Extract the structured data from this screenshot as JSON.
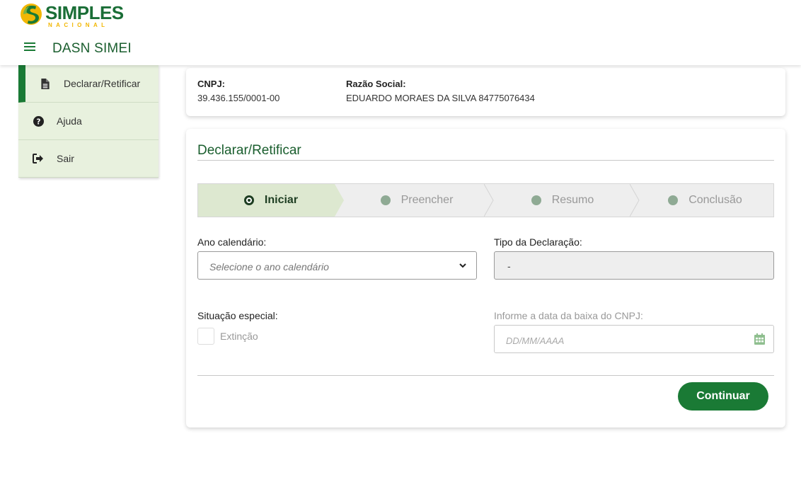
{
  "header": {
    "logo": {
      "main": "SIMPLES",
      "sub": "NACIONAL"
    },
    "app_title": "DASN SIMEI",
    "menu_icon": "hamburger-icon"
  },
  "sidebar": {
    "items": [
      {
        "label": "Declarar/Retificar",
        "icon": "file-icon",
        "active": true
      },
      {
        "label": "Ajuda",
        "icon": "question-circle-icon",
        "active": false
      },
      {
        "label": "Sair",
        "icon": "sign-out-icon",
        "active": false
      }
    ]
  },
  "info": {
    "cnpj_label": "CNPJ:",
    "cnpj_value": "39.436.155/0001-00",
    "razao_label": "Razão Social:",
    "razao_value": "EDUARDO MORAES DA SILVA 84775076434"
  },
  "main": {
    "title": "Declarar/Retificar",
    "steps": [
      {
        "label": "Iniciar",
        "active": true
      },
      {
        "label": "Preencher",
        "active": false
      },
      {
        "label": "Resumo",
        "active": false
      },
      {
        "label": "Conclusão",
        "active": false
      }
    ],
    "ano_label": "Ano calendário:",
    "ano_placeholder": "Selecione o ano calendário",
    "tipo_label": "Tipo da Declaração:",
    "tipo_value": "-",
    "situacao_label": "Situação especial:",
    "extincao_label": "Extinção",
    "baixa_label": "Informe a data da baixa do CNPJ:",
    "baixa_placeholder": "DD/MM/AAAA",
    "continue_label": "Continuar"
  },
  "colors": {
    "primary": "#1a7a35",
    "title_green": "#1a5e2e",
    "sidebar_bg": "#e8f1de",
    "step_active_bg": "#dde8d0",
    "logo_yellow": "#f2b705"
  }
}
